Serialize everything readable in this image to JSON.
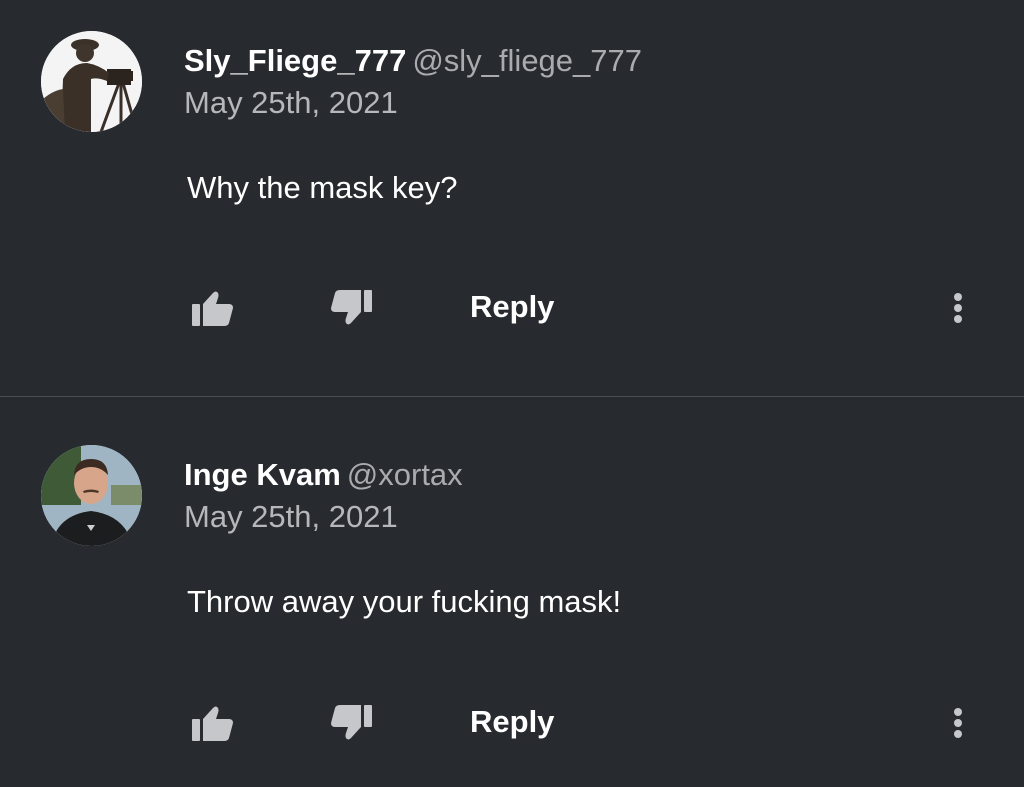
{
  "comments": [
    {
      "author": "Sly_Fliege_777",
      "handle": "@sly_fliege_777",
      "date": "May 25th, 2021",
      "text": "Why the mask key?",
      "reply_label": "Reply",
      "avatar_icon": "person-with-camera-avatar"
    },
    {
      "author": "Inge Kvam",
      "handle": "@xortax",
      "date": "May 25th, 2021",
      "text": "Throw away your fucking mask!",
      "reply_label": "Reply",
      "avatar_icon": "man-portrait-avatar"
    }
  ],
  "colors": {
    "background": "#272a2e",
    "divider": "#4a4d52",
    "handle": "#a9abaf",
    "icon": "#c5c7ca"
  }
}
